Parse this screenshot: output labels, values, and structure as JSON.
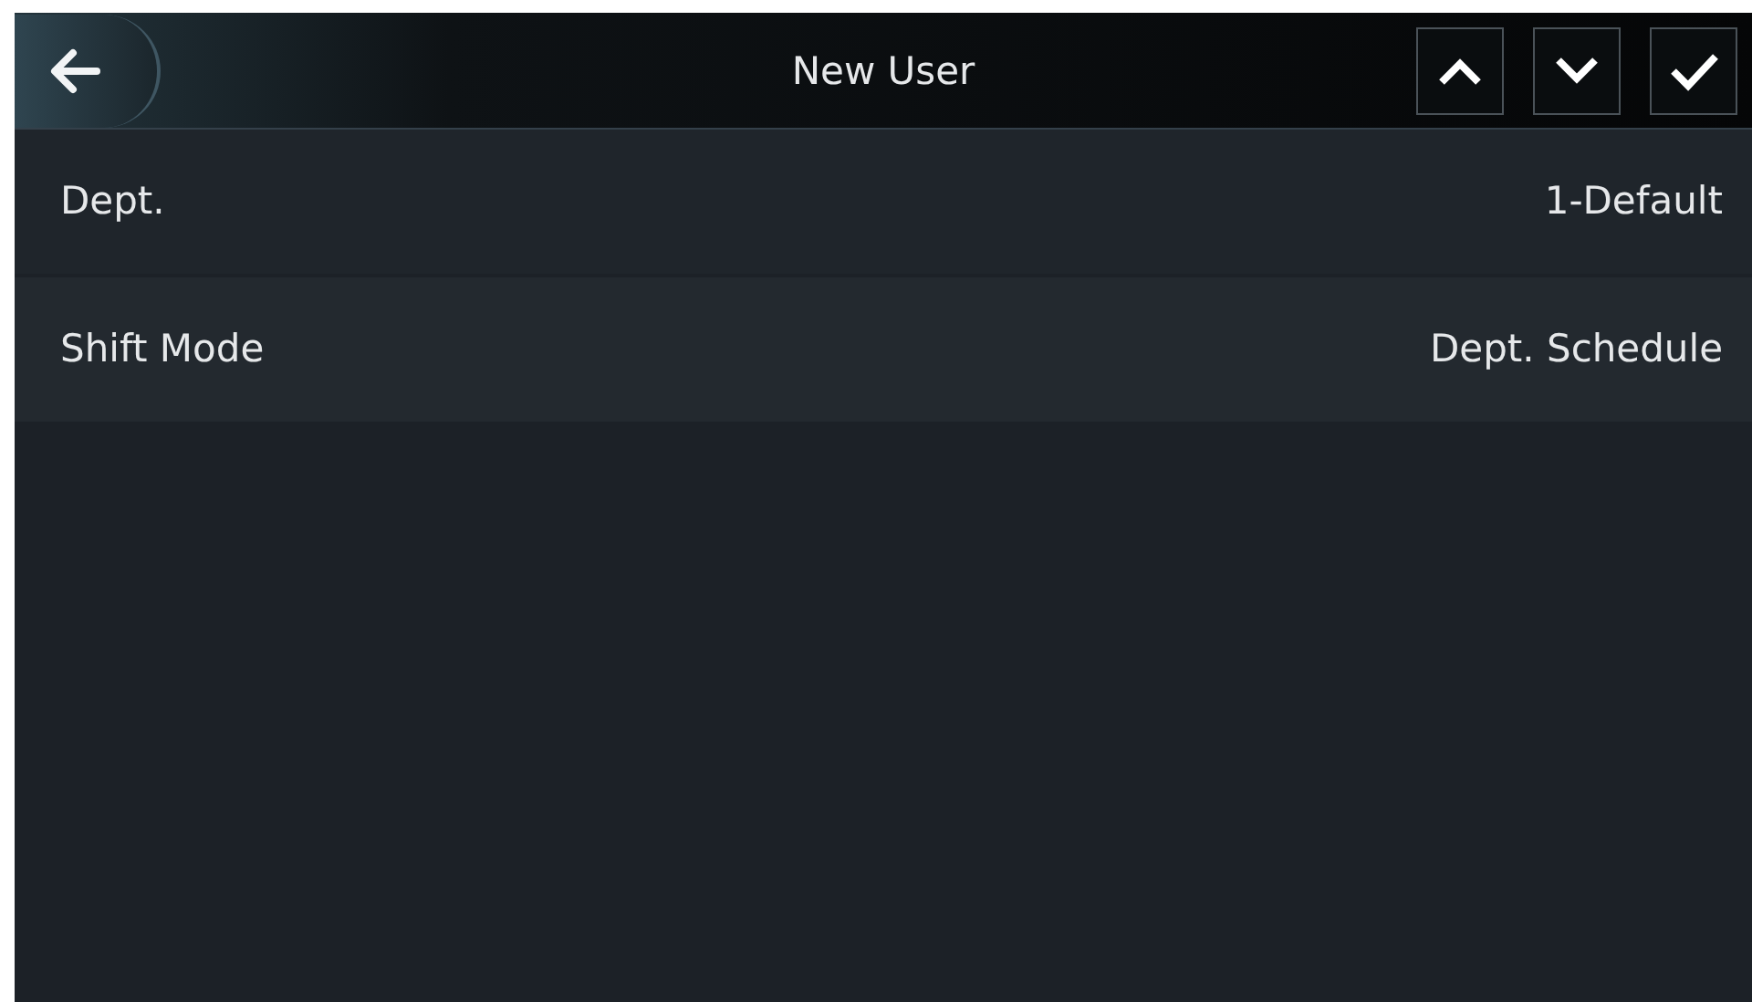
{
  "header": {
    "title": "New User"
  },
  "rows": [
    {
      "label": "Dept.",
      "value": "1-Default"
    },
    {
      "label": "Shift Mode",
      "value": "Dept. Schedule"
    }
  ]
}
